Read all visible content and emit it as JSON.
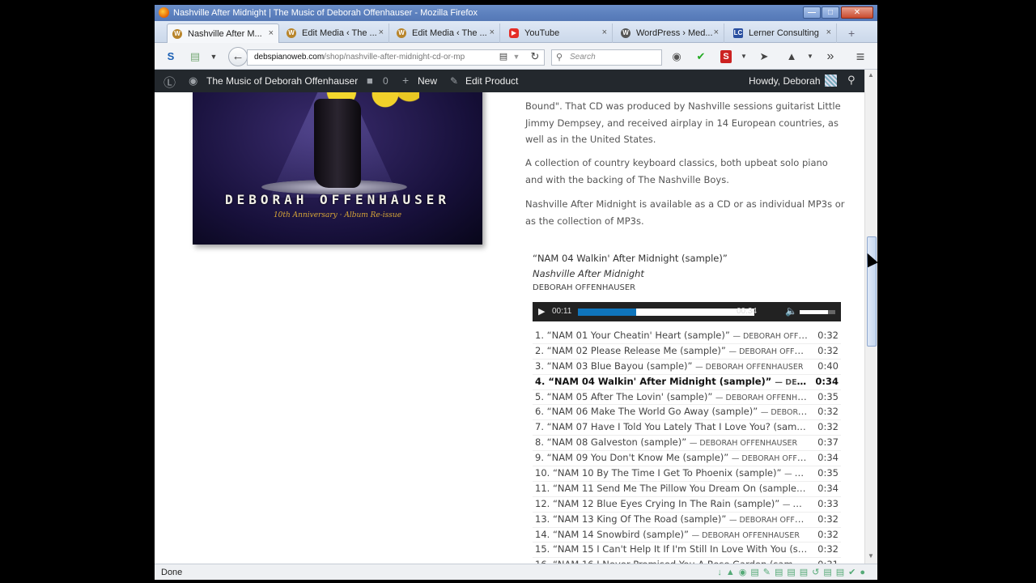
{
  "window": {
    "title": "Nashville After Midnight | The Music of Deborah Offenhauser - Mozilla Firefox",
    "buttons": {
      "minimize": "—",
      "maximize": "□",
      "close": "✕"
    }
  },
  "tabs": [
    {
      "label": "Nashville After M...",
      "icon": "wordpress-icon",
      "active": true
    },
    {
      "label": "Edit Media ‹ The ...",
      "icon": "wordpress-icon",
      "active": false
    },
    {
      "label": "Edit Media ‹ The ...",
      "icon": "wordpress-icon",
      "active": false
    },
    {
      "label": "YouTube",
      "icon": "youtube-icon",
      "active": false
    },
    {
      "label": "WordPress › Med...",
      "icon": "wordpress-icon",
      "active": false
    },
    {
      "label": "Lerner Consulting",
      "icon": "lc-icon",
      "active": false
    }
  ],
  "tab_close_glyph": "×",
  "new_tab_glyph": "+",
  "navbar": {
    "back_glyph": "←",
    "url_host": "debspianoweb.com",
    "url_path": "/shop/nashville-after-midnight-cd-or-mp",
    "search_placeholder": "Search",
    "reload_glyph": "↻",
    "s_glyph": "S",
    "menu_glyph": "≡",
    "overflow_glyph": "»"
  },
  "wpbar": {
    "site_name": "The Music of Deborah Offenhauser",
    "comments_count": "0",
    "new_label": "New",
    "edit_label": "Edit Product",
    "howdy": "Howdy, Deborah"
  },
  "album_art": {
    "artist": "DEBORAH OFFENHAUSER",
    "subtitle": "10th Anniversary · Album Re-issue"
  },
  "paragraphs": [
    "Bound\". That CD was produced by Nashville sessions guitarist Little Jimmy Dempsey, and received airplay in 14 European countries, as well as in the United States.",
    "A collection of country keyboard classics, both upbeat solo piano and with the backing of The Nashville Boys.",
    "Nashville After Midnight is available as a CD or as individual MP3s or as the collection of MP3s."
  ],
  "player": {
    "current_title": "“NAM 04 Walkin' After Midnight (sample)”",
    "current_album": "Nashville After Midnight",
    "current_artist": "DEBORAH OFFENHAUSER",
    "elapsed": "00:11",
    "duration": "00:34",
    "progress_fraction": 0.33,
    "volume_fraction": 0.8,
    "play_glyph": "▶",
    "volume_glyph": "🔈"
  },
  "tracks": [
    {
      "title": "1. “NAM 01 Your Cheatin' Heart (sample)”",
      "artist": "— DEBORAH OFFE...",
      "duration": "0:32"
    },
    {
      "title": "2. “NAM 02 Please Release Me (sample)”",
      "artist": "— DEBORAH OFFEN...",
      "duration": "0:32"
    },
    {
      "title": "3. “NAM 03 Blue Bayou (sample)”",
      "artist": "— DEBORAH OFFENHAUSER",
      "duration": "0:40"
    },
    {
      "title": "4. “NAM 04 Walkin' After Midnight (sample)”",
      "artist": "— DEBORA...",
      "duration": "0:34",
      "playing": true
    },
    {
      "title": "5. “NAM 05 After The Lovin' (sample)”",
      "artist": "— DEBORAH OFFENHAUS...",
      "duration": "0:35"
    },
    {
      "title": "6. “NAM 06 Make The World Go Away (sample)”",
      "artist": "— DEBORAH...",
      "duration": "0:32"
    },
    {
      "title": "7. “NAM 07 Have I Told You Lately That I Love You? (sampl...",
      "artist": "",
      "duration": "0:32"
    },
    {
      "title": "8. “NAM 08 Galveston (sample)”",
      "artist": "— DEBORAH OFFENHAUSER",
      "duration": "0:37"
    },
    {
      "title": "9. “NAM 09 You Don't Know Me (sample)”",
      "artist": "— DEBORAH OFFE...",
      "duration": "0:34"
    },
    {
      "title": "10. “NAM 10 By The Time I Get To Phoenix (sample)”",
      "artist": "— DEB...",
      "duration": "0:35"
    },
    {
      "title": "11. “NAM 11 Send Me The Pillow You Dream On (sample)” ...",
      "artist": "",
      "duration": "0:34"
    },
    {
      "title": "12. “NAM 12 Blue Eyes Crying In The Rain (sample)”",
      "artist": "— DEB...",
      "duration": "0:33"
    },
    {
      "title": "13. “NAM 13 King Of The Road (sample)”",
      "artist": "— DEBORAH OFFEN...",
      "duration": "0:32"
    },
    {
      "title": "14. “NAM 14 Snowbird (sample)”",
      "artist": "— DEBORAH OFFENHAUSER",
      "duration": "0:32"
    },
    {
      "title": "15. “NAM 15 I Can't Help It If I'm Still In Love With You (sam...",
      "artist": "",
      "duration": "0:32"
    },
    {
      "title": "16. “NAM 16 I Never Promised You A Rose Garden (sample...",
      "artist": "",
      "duration": "0:31"
    }
  ],
  "statusbar": {
    "text": "Done"
  }
}
